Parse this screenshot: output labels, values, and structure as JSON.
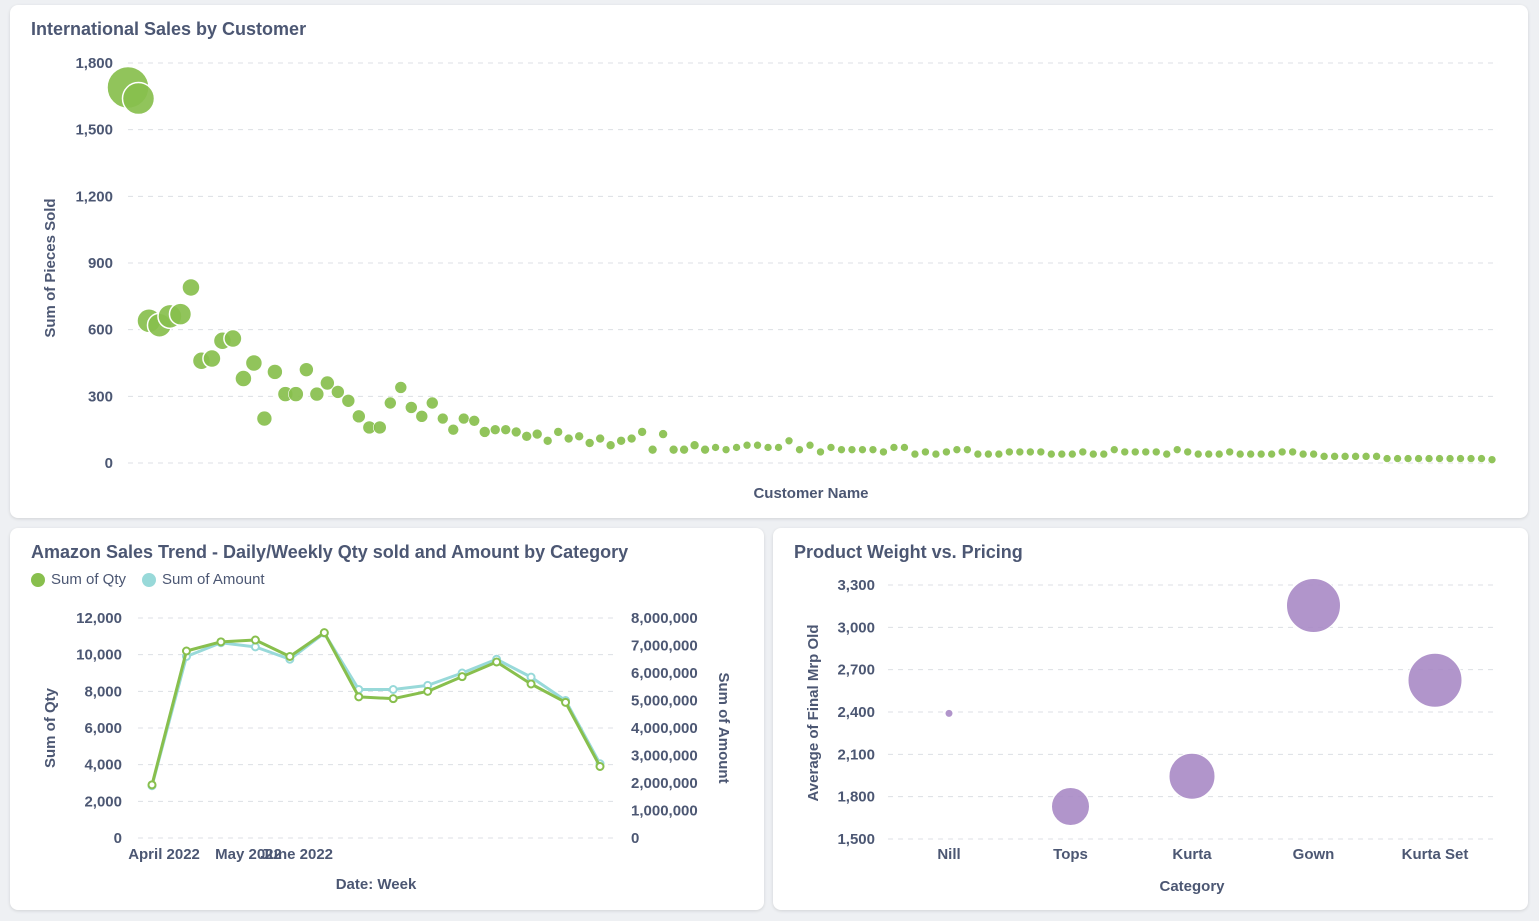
{
  "chart_data": [
    {
      "type": "scatter",
      "title": "International Sales by Customer",
      "xlabel": "Customer Name",
      "ylabel": "Sum of Pieces Sold",
      "ylim": [
        0,
        1800
      ],
      "yticks": [
        0,
        300,
        600,
        900,
        1200,
        1500,
        1800
      ],
      "ytick_labels": [
        "0",
        "300",
        "600",
        "900",
        "1,200",
        "1,500",
        "1,800"
      ],
      "color": "#88bf4d",
      "grid": true,
      "values": [
        1690,
        1640,
        640,
        620,
        660,
        670,
        790,
        460,
        470,
        550,
        560,
        380,
        450,
        200,
        410,
        310,
        310,
        420,
        310,
        360,
        320,
        280,
        210,
        160,
        160,
        270,
        340,
        250,
        210,
        270,
        200,
        150,
        200,
        190,
        140,
        150,
        150,
        140,
        120,
        130,
        100,
        140,
        110,
        120,
        90,
        110,
        80,
        100,
        110,
        140,
        60,
        130,
        60,
        60,
        80,
        60,
        70,
        60,
        70,
        80,
        80,
        70,
        70,
        100,
        60,
        80,
        50,
        70,
        60,
        60,
        60,
        60,
        50,
        70,
        70,
        40,
        50,
        40,
        50,
        60,
        60,
        40,
        40,
        40,
        50,
        50,
        50,
        50,
        40,
        40,
        40,
        50,
        40,
        40,
        60,
        50,
        50,
        50,
        50,
        40,
        60,
        50,
        40,
        40,
        40,
        50,
        40,
        40,
        40,
        40,
        50,
        50,
        40,
        40,
        30,
        30,
        30,
        30,
        30,
        30,
        20,
        20,
        20,
        20,
        20,
        20,
        20,
        20,
        20,
        20,
        15
      ],
      "sizes": [
        42,
        32,
        24,
        24,
        24,
        22,
        18,
        18,
        18,
        18,
        18,
        17,
        17,
        15,
        15,
        15,
        15,
        14,
        14,
        14,
        13,
        13,
        13,
        13,
        13,
        12,
        12,
        12,
        12,
        12,
        11,
        11,
        11,
        11,
        11,
        10,
        10,
        10,
        10,
        10,
        9,
        9,
        9,
        9,
        9,
        9,
        9,
        9,
        9,
        9,
        9,
        9,
        9,
        9,
        9,
        9,
        8,
        8,
        8,
        8,
        8,
        8,
        8,
        8,
        8,
        8,
        8,
        8,
        8,
        8,
        8,
        8,
        8,
        8,
        8,
        8,
        8,
        8,
        8,
        8,
        8,
        8,
        8,
        8,
        8,
        8,
        8,
        8,
        8,
        8,
        8,
        8,
        8,
        8,
        8,
        8,
        8,
        8,
        8,
        8,
        8,
        8,
        8,
        8,
        8,
        8,
        8,
        8,
        8,
        8,
        8,
        8,
        8,
        8,
        8,
        8,
        8,
        8,
        8,
        8,
        8,
        8,
        8,
        8,
        8,
        8,
        8,
        8,
        8,
        8,
        8
      ]
    },
    {
      "type": "line",
      "title": "Amazon Sales Trend - Daily/Weekly Qty sold and Amount by Category",
      "xlabel": "Date: Week",
      "ylabel": "Sum of Qty",
      "ylabel_right": "Sum of Amount",
      "x_tick_labels": [
        "April 2022",
        "May 2022",
        "June 2022"
      ],
      "x_tick_index": [
        0.35,
        2.8,
        4.2
      ],
      "ylim": [
        0,
        12000
      ],
      "yticks": [
        0,
        2000,
        4000,
        6000,
        8000,
        10000,
        12000
      ],
      "ytick_labels": [
        "0",
        "2,000",
        "4,000",
        "6,000",
        "8,000",
        "10,000",
        "12,000"
      ],
      "ylim_right": [
        0,
        8000000
      ],
      "yticks_right": [
        0,
        1000000,
        2000000,
        3000000,
        4000000,
        5000000,
        6000000,
        7000000,
        8000000
      ],
      "ytick_labels_right": [
        "0",
        "1,000,000",
        "2,000,000",
        "3,000,000",
        "4,000,000",
        "5,000,000",
        "6,000,000",
        "7,000,000",
        "8,000,000"
      ],
      "legend": "top-left",
      "series": [
        {
          "name": "Sum of Qty",
          "color": "#88bf4d",
          "axis": "left",
          "values": [
            2900,
            10200,
            10700,
            10800,
            9900,
            11200,
            7700,
            7600,
            8000,
            8800,
            9600,
            8400,
            7400,
            3900
          ]
        },
        {
          "name": "Sum of Amount",
          "color": "#98d9d9",
          "axis": "right",
          "values": [
            1900000,
            6600000,
            7100000,
            6950000,
            6500000,
            7450000,
            5400000,
            5400000,
            5550000,
            6000000,
            6500000,
            5850000,
            5000000,
            2700000
          ]
        }
      ]
    },
    {
      "type": "scatter",
      "title": "Product Weight vs. Pricing",
      "xlabel": "Category",
      "ylabel": "Average of Final Mrp Old",
      "categories": [
        "Nill",
        "Tops",
        "Kurta",
        "Gown",
        "Kurta Set"
      ],
      "values": [
        2390,
        1730,
        1945,
        3155,
        2625
      ],
      "sizes": [
        4,
        19,
        23,
        27,
        27
      ],
      "color": "#a989c5",
      "ylim": [
        1500,
        3300
      ],
      "yticks": [
        1500,
        1800,
        2100,
        2400,
        2700,
        3000,
        3300
      ],
      "ytick_labels": [
        "1,500",
        "1,800",
        "2,100",
        "2,400",
        "2,700",
        "3,000",
        "3,300"
      ]
    }
  ]
}
